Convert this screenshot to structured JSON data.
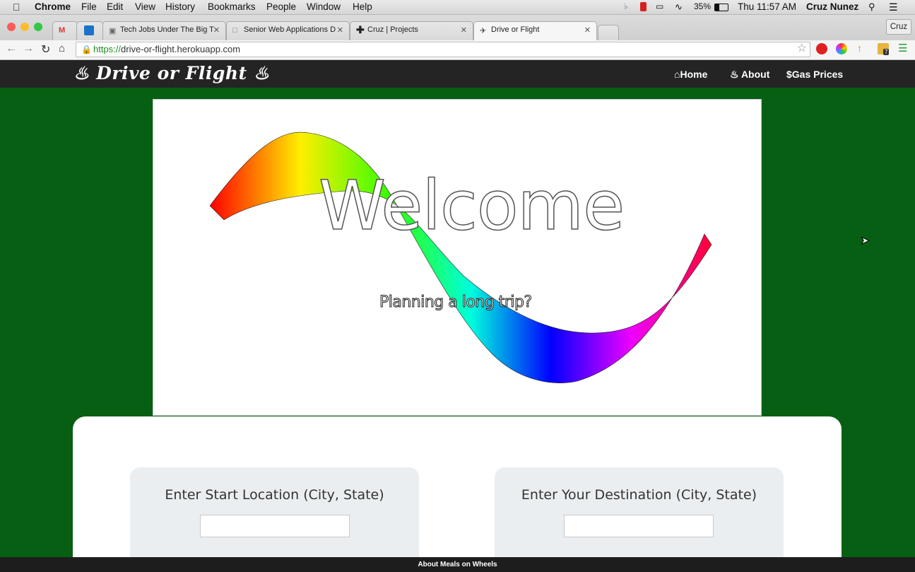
{
  "menubar": {
    "apple_icon": "apple-icon",
    "app": "Chrome",
    "items": [
      "File",
      "Edit",
      "View",
      "History",
      "Bookmarks",
      "People",
      "Window",
      "Help"
    ],
    "battery": "35%",
    "clock": "Thu 11:57 AM",
    "user": "Cruz Nunez"
  },
  "tabs": [
    {
      "title": ""
    },
    {
      "title": ""
    },
    {
      "title": "Tech Jobs Under The Big T"
    },
    {
      "title": "Senior Web Applications D"
    },
    {
      "title": "Cruz | Projects"
    },
    {
      "title": "Drive or Flight"
    }
  ],
  "profile": "Cruz",
  "toolbar": {
    "url_scheme": "https://",
    "url_host": "drive-or-flight.herokuapp.com",
    "ext_badge": "7"
  },
  "site": {
    "brand": "Drive or Flight",
    "nav": [
      {
        "label": "Home",
        "icon": "home-icon"
      },
      {
        "label": "About",
        "icon": "flame-icon"
      },
      {
        "label": "Gas Prices",
        "icon": "dollar-icon"
      }
    ]
  },
  "hero": {
    "headline": "Welcome",
    "tagline": "Planning a long trip?"
  },
  "form": {
    "start_label": "Enter Start Location (City, State)",
    "start_value": "",
    "dest_label": "Enter Your Destination (City, State)",
    "dest_value": ""
  },
  "footer": "About Meals on Wheels",
  "colors": {
    "page_bg": "#075f14",
    "navbar": "#242424"
  }
}
